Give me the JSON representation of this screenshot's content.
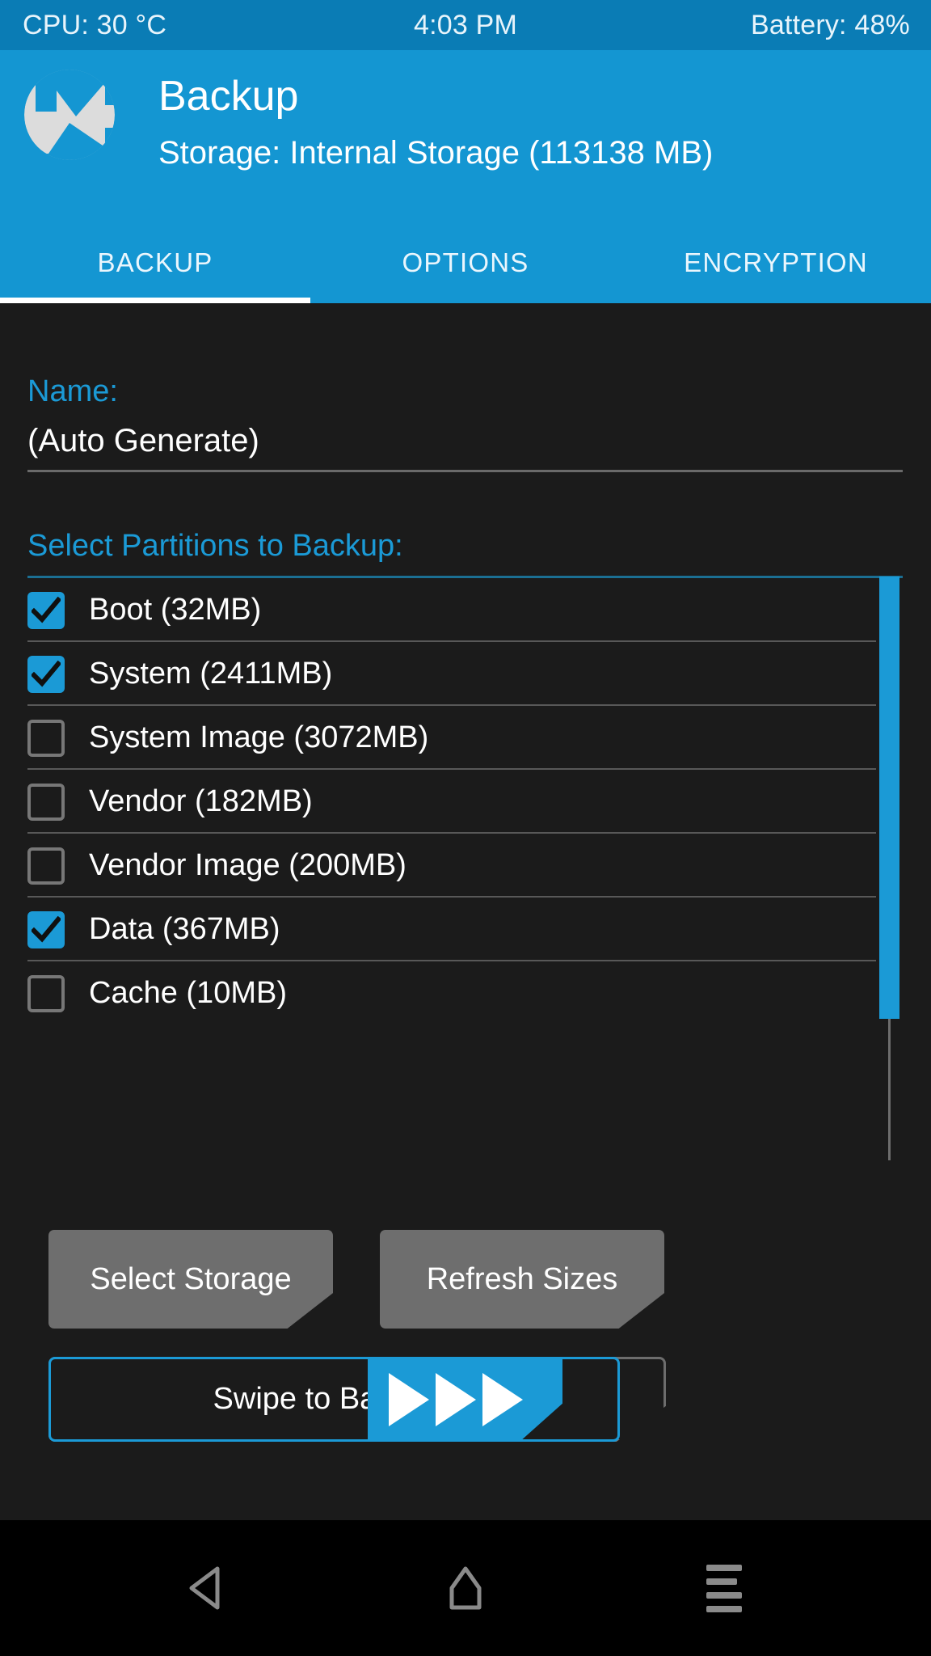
{
  "status_bar": {
    "cpu": "CPU: 30 °C",
    "time": "4:03 PM",
    "battery": "Battery: 48%",
    "background_color": "#0a7cb5"
  },
  "header": {
    "title": "Backup",
    "storage_line": "Storage: Internal Storage (113138 MB)",
    "logo_name": "twrp-logo",
    "background_color": "#1496d2"
  },
  "tabs": {
    "items": [
      {
        "label": "BACKUP",
        "active": true
      },
      {
        "label": "OPTIONS",
        "active": false
      },
      {
        "label": "ENCRYPTION",
        "active": false
      }
    ],
    "active_underline_color": "#ffffff"
  },
  "backup_form": {
    "name_label": "Name:",
    "name_value": "(Auto Generate)",
    "name_placeholder": "(Auto Generate)",
    "partitions_label": "Select Partitions to Backup:",
    "label_color": "#1b9ad6"
  },
  "partitions": [
    {
      "label": "Boot (32MB)",
      "checked": true
    },
    {
      "label": "System (2411MB)",
      "checked": true
    },
    {
      "label": "System Image (3072MB)",
      "checked": false
    },
    {
      "label": "Vendor (182MB)",
      "checked": false
    },
    {
      "label": "Vendor Image (200MB)",
      "checked": false
    },
    {
      "label": "Data (367MB)",
      "checked": true
    },
    {
      "label": "Cache (10MB)",
      "checked": false
    }
  ],
  "scrollbar": {
    "thumb_color": "#1b9ad6",
    "track_color": "#6d6d6d"
  },
  "actions": {
    "select_storage": "Select Storage",
    "refresh_sizes": "Refresh Sizes",
    "button_color": "#6e6e6e"
  },
  "swipe": {
    "text": "Swipe to Back Up",
    "accent_color": "#1b9ad6",
    "arrow_count": 3
  },
  "navbar": {
    "back_icon": "back-triangle-icon",
    "home_icon": "home-icon",
    "menu_icon": "menu-icon"
  }
}
